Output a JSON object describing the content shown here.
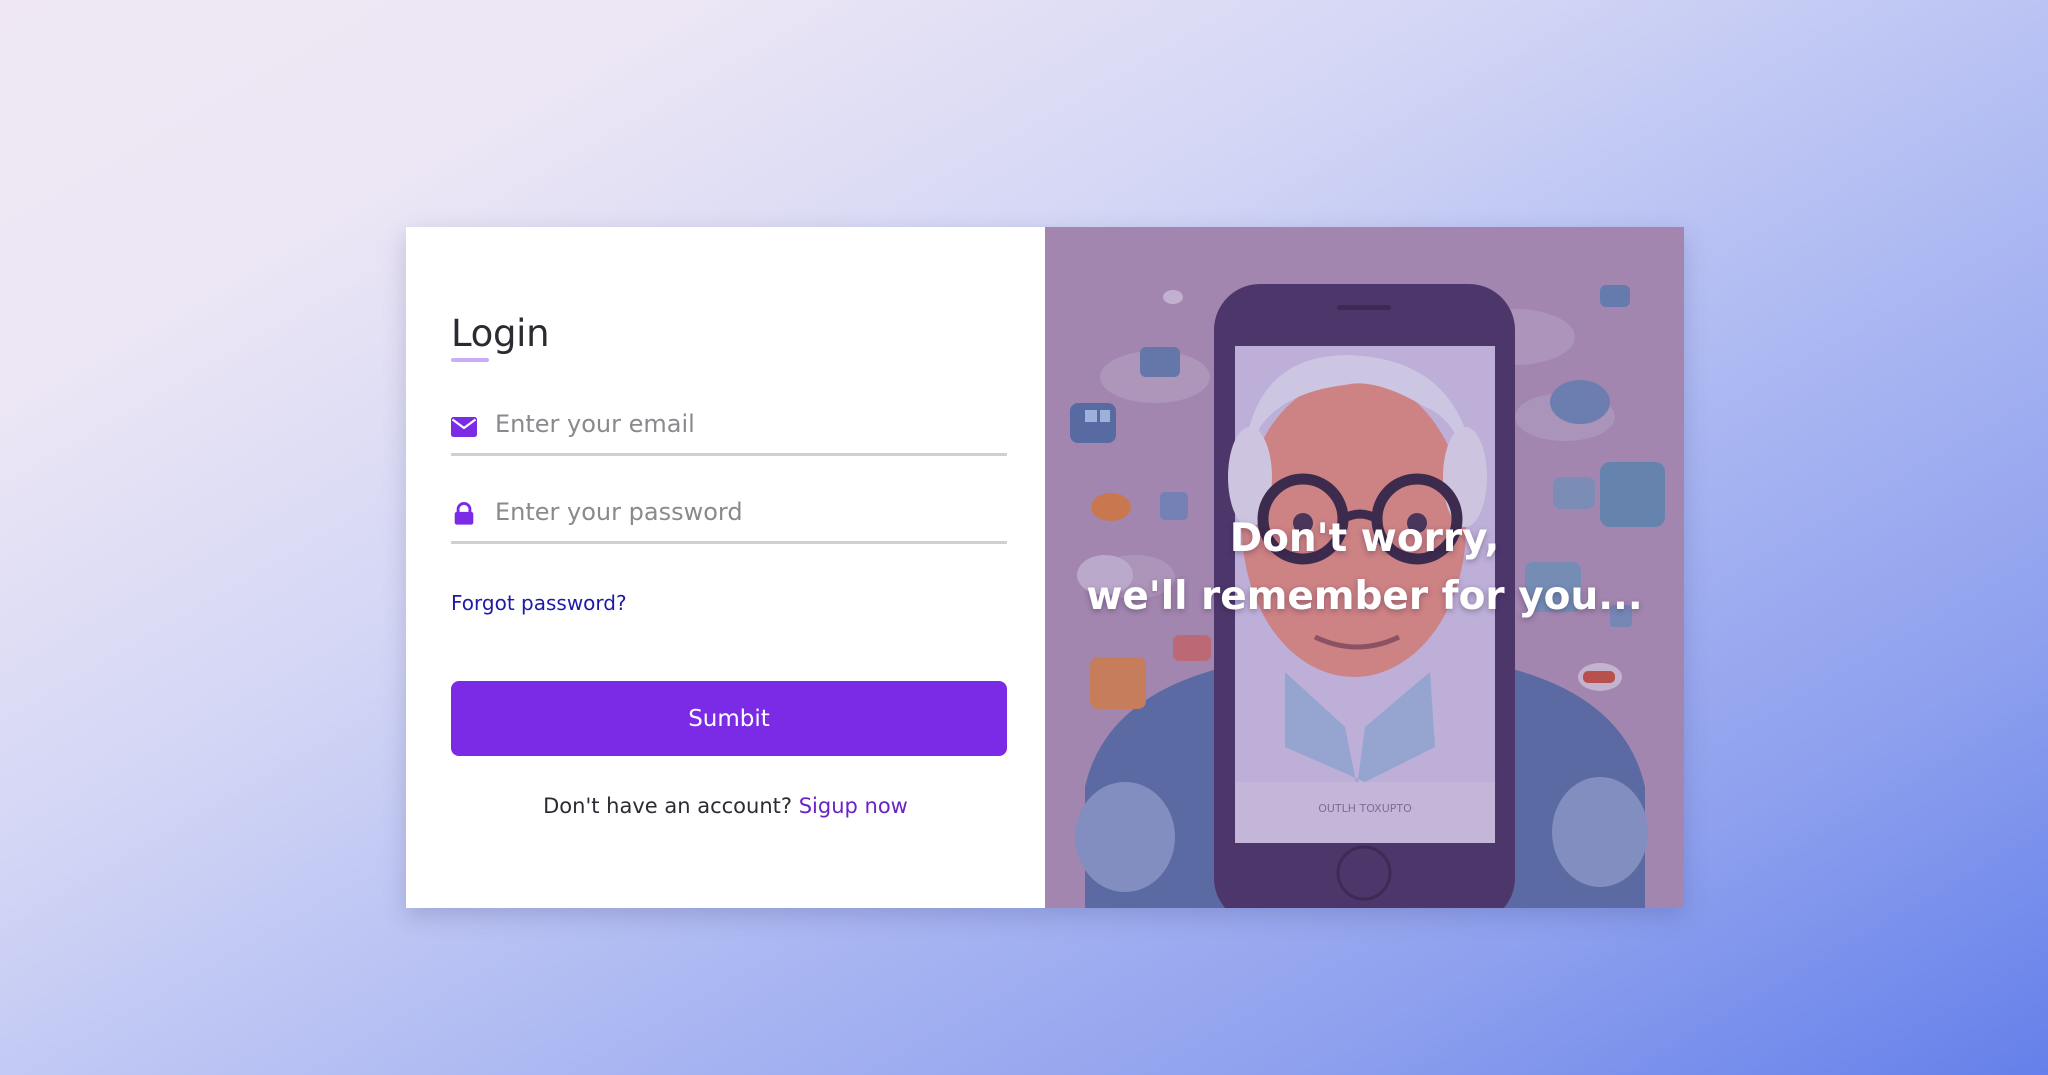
{
  "login": {
    "title": "Login",
    "email": {
      "placeholder": "Enter your email",
      "value": "",
      "icon": "envelope-icon"
    },
    "password": {
      "placeholder": "Enter your password",
      "value": "",
      "icon": "lock-icon"
    },
    "forgot_label": "Forgot password?",
    "submit_label": "Sumbit",
    "signup_prompt": "Don't have an account?",
    "signup_link": "Sigup now"
  },
  "promo": {
    "line1": "Don't worry,",
    "line2": "we'll remember for you...",
    "phone_screen_text": "OUTLH TOXUPTO"
  },
  "colors": {
    "accent": "#7b2be6",
    "link": "#1d1aa8",
    "signup_link": "#6a22c9",
    "title_underline": "#c9adf6"
  }
}
